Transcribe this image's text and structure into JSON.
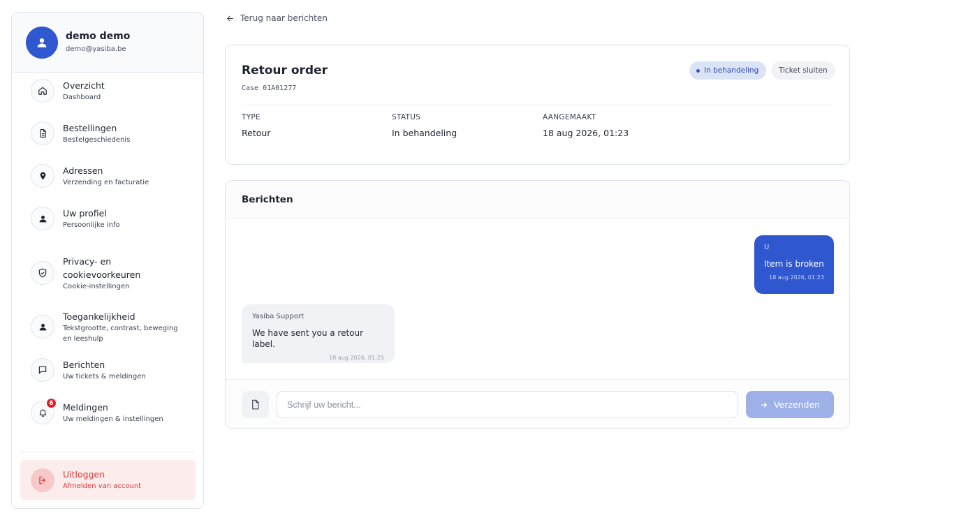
{
  "user": {
    "name": "demo demo",
    "email": "demo@yasiba.be"
  },
  "nav": {
    "overview": {
      "label": "Overzicht",
      "sub": "Dashboard"
    },
    "orders": {
      "label": "Bestellingen",
      "sub": "Bestelgeschiedenis"
    },
    "addresses": {
      "label": "Adressen",
      "sub": "Verzending en facturatie"
    },
    "profile": {
      "label": "Uw profiel",
      "sub": "Persoonlijke info"
    },
    "privacy": {
      "label_line1": "Privacy- en",
      "label_line2": "cookievoorkeuren",
      "sub": "Cookie-instellingen"
    },
    "accessibility": {
      "label": "Toegankelijkheid",
      "sub_line1": "Tekstgrootte, contrast, beweging",
      "sub_line2": "en leeshulp"
    },
    "messages": {
      "label": "Berichten",
      "sub": "Uw tickets & meldingen"
    },
    "notifications": {
      "label": "Meldingen",
      "sub": "Uw meldingen & instellingen",
      "badge": "6"
    },
    "logout": {
      "label": "Uitloggen",
      "sub": "Afmelden van account"
    }
  },
  "back_link": "Terug naar berichten",
  "ticket": {
    "title": "Retour order",
    "case": "Case 01A01277",
    "status_pill": "In behandeling",
    "close_button": "Ticket sluiten",
    "meta": [
      {
        "label": "TYPE",
        "value": "Retour"
      },
      {
        "label": "STATUS",
        "value": "In behandeling"
      },
      {
        "label": "AANGEMAAKT",
        "value": "18 aug 2026, 01:23"
      }
    ]
  },
  "messages": {
    "title": "Berichten",
    "outgoing": {
      "sender": "U",
      "text": "Item is broken",
      "time": "18 aug 2026, 01:23"
    },
    "incoming": {
      "sender": "Yasiba Support",
      "text": "We have sent you a retour label.",
      "time": "18 aug 2026, 01:25"
    },
    "composer": {
      "placeholder": "Schrijf uw bericht...",
      "send_label": "Verzenden"
    }
  },
  "colors": {
    "accent": "#2f57cf",
    "danger": "#dc3b3b",
    "badge": "#e11d28"
  }
}
